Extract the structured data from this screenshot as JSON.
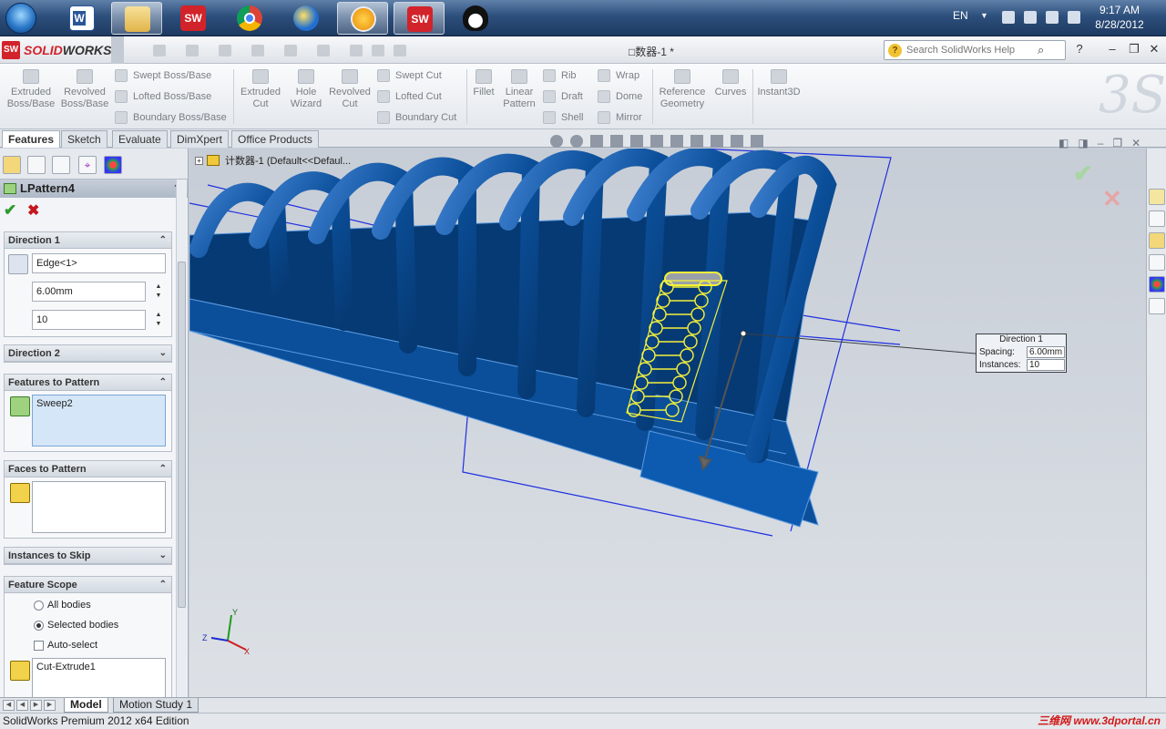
{
  "taskbar": {
    "language": "EN",
    "time": "9:17 AM",
    "date": "8/28/2012",
    "apps": [
      "windows-explorer",
      "microsoft-word",
      "file-explorer",
      "solidworks",
      "google-chrome",
      "internet-app",
      "weather-app",
      "solidworks",
      "qq-messenger"
    ]
  },
  "titlebar": {
    "logo_prefix": "SOLID",
    "logo_suffix": "WORKS",
    "document_title": "□数器-1 *",
    "search_placeholder": "Search SolidWorks Help"
  },
  "ribbon": {
    "extruded_boss": "Extruded Boss/Base",
    "revolved_boss": "Revolved Boss/Base",
    "swept_boss": "Swept Boss/Base",
    "lofted_boss": "Lofted Boss/Base",
    "boundary_boss": "Boundary Boss/Base",
    "extruded_cut": "Extruded Cut",
    "hole_wizard": "Hole Wizard",
    "revolved_cut": "Revolved Cut",
    "swept_cut": "Swept Cut",
    "lofted_cut": "Lofted Cut",
    "boundary_cut": "Boundary Cut",
    "fillet": "Fillet",
    "linear_pattern": "Linear Pattern",
    "rib": "Rib",
    "draft": "Draft",
    "shell": "Shell",
    "wrap": "Wrap",
    "dome": "Dome",
    "mirror": "Mirror",
    "reference_geometry": "Reference Geometry",
    "curves": "Curves",
    "instant3d": "Instant3D"
  },
  "tabs": [
    "Features",
    "Sketch",
    "Evaluate",
    "DimXpert",
    "Office Products"
  ],
  "property_manager": {
    "title": "LPattern4",
    "help": "?",
    "direction1": {
      "header": "Direction 1",
      "edge": "Edge<1>",
      "spacing": "6.00mm",
      "instances": "10"
    },
    "direction2_header": "Direction 2",
    "features_to_pattern": {
      "header": "Features to Pattern",
      "item": "Sweep2"
    },
    "faces_to_pattern_header": "Faces to Pattern",
    "instances_to_skip_header": "Instances to Skip",
    "feature_scope": {
      "header": "Feature Scope",
      "all_bodies": "All bodies",
      "selected_bodies": "Selected bodies",
      "auto_select": "Auto-select",
      "body": "Cut-Extrude1"
    }
  },
  "viewport": {
    "tree_node": "计数器-1  (Default<<Defaul...",
    "callout": {
      "title": "Direction 1",
      "spacing_label": "Spacing:",
      "spacing_value": "6.00mm",
      "instances_label": "Instances:",
      "instances_value": "10"
    }
  },
  "bottom_tabs": [
    "Model",
    "Motion Study 1"
  ],
  "status": {
    "text": "SolidWorks Premium 2012 x64 Edition",
    "watermark": "三维网 www.3dportal.cn"
  },
  "colors": {
    "part_blue": "#0b4f9a",
    "part_dark": "#06356b",
    "highlight_yellow": "#f5f23a",
    "solidworks_red": "#d2232a"
  }
}
